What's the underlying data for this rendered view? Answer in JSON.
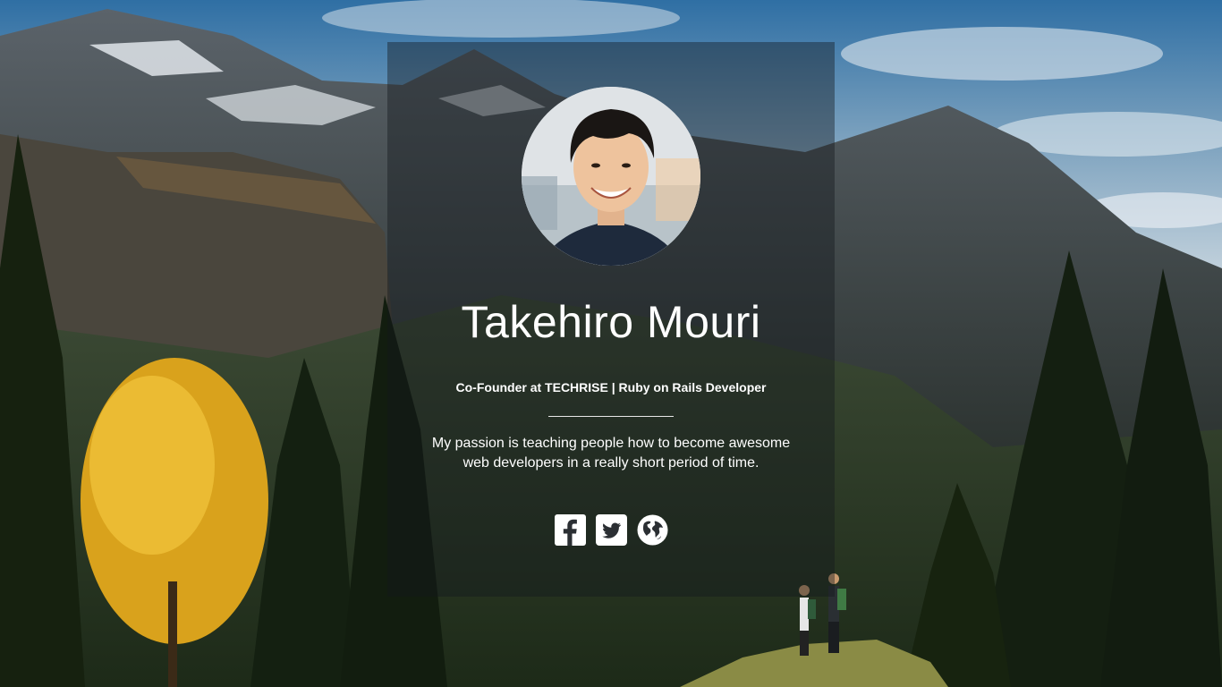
{
  "profile": {
    "name": "Takehiro Mouri",
    "role": "Co-Founder at TECHRISE | Ruby on Rails Developer",
    "bio": "My passion is teaching people how to become awesome web developers in a really short period of time."
  },
  "socials": [
    {
      "icon": "facebook-icon"
    },
    {
      "icon": "twitter-icon"
    },
    {
      "icon": "globe-icon"
    }
  ],
  "colors": {
    "text": "#ffffff",
    "card_overlay": "rgba(20,24,28,0.42)",
    "foliage_yellow": "#e6b422"
  }
}
